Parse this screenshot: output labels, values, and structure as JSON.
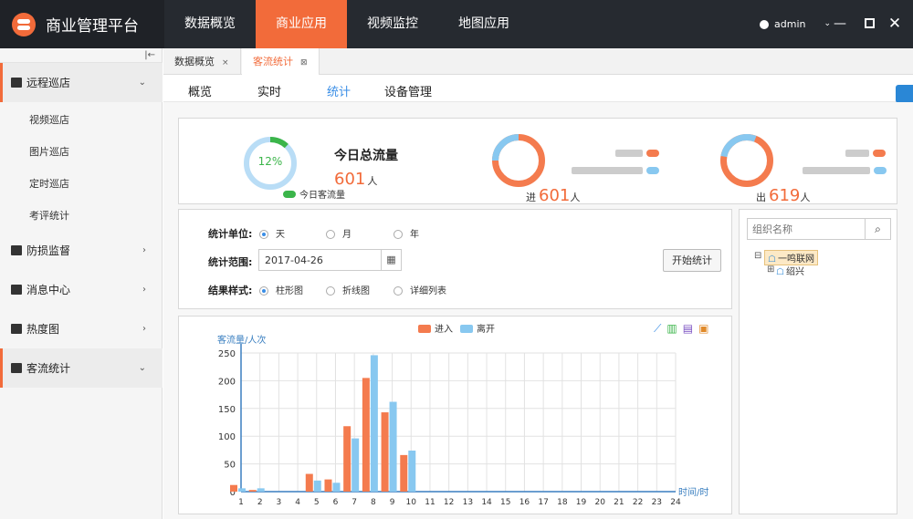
{
  "app": {
    "title": "商业管理平台"
  },
  "nav": [
    "数据概览",
    "商业应用",
    "视频监控",
    "地图应用"
  ],
  "user": {
    "name": "admin"
  },
  "sidebar": {
    "collapse_glyph": "|←",
    "groups": [
      {
        "label": "远程巡店",
        "icon": "store-icon",
        "arrow": "⌄",
        "subs": [
          "视频巡店",
          "图片巡店",
          "定时巡店",
          "考评统计"
        ]
      },
      {
        "label": "防损监督",
        "icon": "shield-icon",
        "arrow": "›"
      },
      {
        "label": "消息中心",
        "icon": "mail-icon",
        "arrow": "›"
      },
      {
        "label": "热度图",
        "icon": "bars-icon",
        "arrow": "›"
      },
      {
        "label": "客流统计",
        "icon": "people-flow-icon",
        "arrow": "⌄"
      }
    ]
  },
  "tabs": [
    {
      "label": "数据概览",
      "close": "×"
    },
    {
      "label": "客流统计",
      "close": "⊠"
    }
  ],
  "subtabs": [
    "概览",
    "实时",
    "统计",
    "设备管理"
  ],
  "summary": {
    "percent": "12%",
    "legend": "今日客流量",
    "title": "今日总流量",
    "total": "601",
    "unit": "人",
    "in_label": "进",
    "in_value": "601",
    "out_label": "出",
    "out_value": "619",
    "ratio": 0.12
  },
  "form": {
    "unit_label": "统计单位:",
    "unit_options": [
      "天",
      "月",
      "年"
    ],
    "range_label": "统计范围:",
    "date_value": "2017-04-26",
    "style_label": "结果样式:",
    "style_options": [
      "柱形图",
      "折线图",
      "详细列表"
    ],
    "start_button": "开始统计"
  },
  "tree": {
    "search_placeholder": "组织名称",
    "root": "一鸣联网",
    "child": "绍兴",
    "collapse_glyph": "⊟",
    "expand_glyph": "⊞"
  },
  "colors": {
    "accent": "#f26b3a",
    "in": "#f47b4e",
    "out": "#88c8f0",
    "blue": "#3a8ee6"
  },
  "chart_data": {
    "type": "bar",
    "ylabel": "客流量/人次",
    "xlabel": "时间/时",
    "ylim": [
      0,
      250
    ],
    "yticks": [
      "0",
      "50",
      "100",
      "150",
      "200",
      "250"
    ],
    "categories": [
      "1",
      "2",
      "3",
      "4",
      "5",
      "6",
      "7",
      "8",
      "9",
      "10",
      "11",
      "12",
      "13",
      "14",
      "15",
      "16",
      "17",
      "18",
      "19",
      "20",
      "21",
      "22",
      "23",
      "24"
    ],
    "series": [
      {
        "name": "进入",
        "values": [
          12,
          3,
          0,
          0,
          32,
          22,
          118,
          205,
          143,
          66,
          0,
          0,
          0,
          0,
          0,
          0,
          0,
          0,
          0,
          0,
          0,
          0,
          0,
          0
        ]
      },
      {
        "name": "离开",
        "values": [
          6,
          6,
          0,
          0,
          20,
          16,
          96,
          246,
          162,
          74,
          0,
          0,
          0,
          0,
          0,
          0,
          0,
          0,
          0,
          0,
          0,
          0,
          0,
          0
        ]
      }
    ]
  }
}
